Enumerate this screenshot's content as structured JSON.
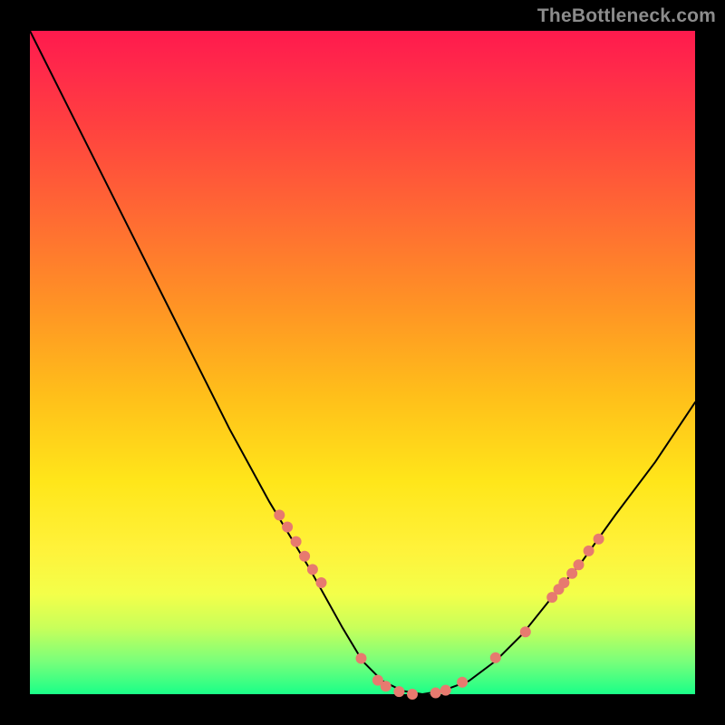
{
  "watermark": "TheBottleneck.com",
  "chart_data": {
    "type": "line",
    "title": "",
    "xlabel": "",
    "ylabel": "",
    "xlim": [
      0,
      100
    ],
    "ylim": [
      0,
      100
    ],
    "series": [
      {
        "name": "bottleneck-curve",
        "x": [
          0,
          6,
          12,
          18,
          24,
          30,
          36,
          42,
          47,
          50,
          53,
          56,
          59,
          62,
          66,
          70,
          74,
          78,
          83,
          88,
          94,
          100
        ],
        "values": [
          100,
          88,
          76,
          64,
          52,
          40,
          29,
          19,
          10,
          5,
          2,
          0.5,
          0,
          0.5,
          2,
          5,
          9,
          14,
          20,
          27,
          35,
          44
        ],
        "stroke": "#000000",
        "stroke_width": 2
      }
    ],
    "highlights": {
      "name": "highlight-dots",
      "color": "#e77a6f",
      "radius": 6,
      "points": [
        {
          "x": 37.5,
          "values": 27.0
        },
        {
          "x": 38.7,
          "values": 25.2
        },
        {
          "x": 40.0,
          "values": 23.0
        },
        {
          "x": 41.3,
          "values": 20.8
        },
        {
          "x": 42.5,
          "values": 18.8
        },
        {
          "x": 43.8,
          "values": 16.8
        },
        {
          "x": 49.8,
          "values": 5.4
        },
        {
          "x": 52.3,
          "values": 2.1
        },
        {
          "x": 53.5,
          "values": 1.2
        },
        {
          "x": 55.5,
          "values": 0.4
        },
        {
          "x": 57.5,
          "values": 0.0
        },
        {
          "x": 61.0,
          "values": 0.2
        },
        {
          "x": 62.5,
          "values": 0.6
        },
        {
          "x": 65.0,
          "values": 1.8
        },
        {
          "x": 70.0,
          "values": 5.5
        },
        {
          "x": 74.5,
          "values": 9.4
        },
        {
          "x": 78.5,
          "values": 14.6
        },
        {
          "x": 79.5,
          "values": 15.8
        },
        {
          "x": 80.3,
          "values": 16.8
        },
        {
          "x": 81.5,
          "values": 18.2
        },
        {
          "x": 82.5,
          "values": 19.5
        },
        {
          "x": 84.0,
          "values": 21.6
        },
        {
          "x": 85.5,
          "values": 23.4
        }
      ]
    }
  }
}
